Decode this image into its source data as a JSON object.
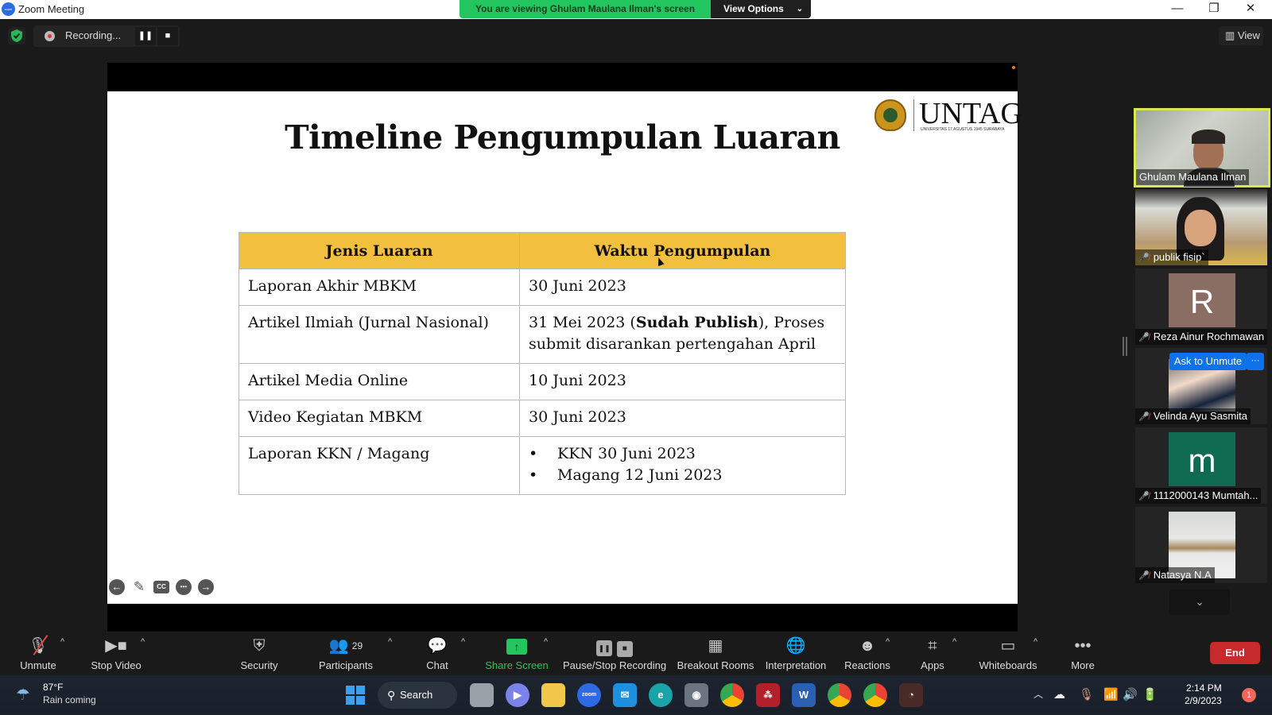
{
  "window": {
    "app_name": "Zoom Meeting",
    "logo_text": "zoom",
    "minimize": "—",
    "restore": "❐",
    "close": "✕"
  },
  "share_banner": {
    "text": "You are viewing Ghulam Maulana Ilman's screen",
    "view_options": "View Options",
    "chevron": "⌄"
  },
  "topbar": {
    "recording_label": "Recording...",
    "pause_glyph": "❚❚",
    "stop_glyph": "■",
    "view_label": "View",
    "view_glyph": "▥"
  },
  "slide": {
    "title": "Timeline Pengumpulan Luaran",
    "logo": {
      "word": "UNTAG",
      "subtitle": "UNIVERSITAS 17 AGUSTUS 1945 SURABAYA"
    },
    "table": {
      "headers": [
        "Jenis Luaran",
        "Waktu Pengumpulan"
      ],
      "rows": [
        {
          "type": "Laporan Akhir MBKM",
          "time": "30 Juni 2023"
        },
        {
          "type": "Artikel Ilmiah (Jurnal Nasional)",
          "time_prefix": "31 Mei 2023 (",
          "time_bold": "Sudah Publish",
          "time_suffix": "), Proses submit disarankan pertengahan April"
        },
        {
          "type": "Artikel Media Online",
          "time": "10 Juni 2023"
        },
        {
          "type": "Video Kegiatan MBKM",
          "time": "30 Juni 2023"
        },
        {
          "type": "Laporan KKN / Magang",
          "time_list": [
            "KKN 30 Juni 2023",
            "Magang 12 Juni 2023"
          ]
        }
      ]
    },
    "controls": {
      "prev": "←",
      "pen": "✎",
      "cc": "CC",
      "more": "•••",
      "next": "→"
    }
  },
  "participants": [
    {
      "name": "Ghulam Maulana Ilman",
      "type": "video",
      "active": true,
      "muted": false
    },
    {
      "name": "publik fisip`",
      "type": "video",
      "muted": true
    },
    {
      "name": "Reza Ainur Rochmawan",
      "type": "avatar",
      "initial": "R",
      "color": "#8a6e63",
      "muted": true
    },
    {
      "name": "Velinda Ayu Sasmita",
      "type": "photo",
      "muted": true
    },
    {
      "name": "1112000143 Mumtah...",
      "type": "avatar",
      "initial": "m",
      "color": "#0f6b52",
      "muted": true
    },
    {
      "name": "Natasya N.A",
      "type": "photo",
      "muted": true
    }
  ],
  "hover_actions": {
    "ask_to_unmute": "Ask to Unmute",
    "more": "···"
  },
  "scroll_down_glyph": "⌄",
  "toolbar": {
    "unmute": "Unmute",
    "stop_video": "Stop Video",
    "security": "Security",
    "participants": "Participants",
    "participants_count": "29",
    "chat": "Chat",
    "share_screen": "Share Screen",
    "pause_stop_recording": "Pause/Stop Recording",
    "breakout_rooms": "Breakout Rooms",
    "interpretation": "Interpretation",
    "reactions": "Reactions",
    "apps": "Apps",
    "whiteboards": "Whiteboards",
    "more": "More",
    "end": "End",
    "caret": "^",
    "share_color": "#22c55e",
    "end_color": "#c72a2a"
  },
  "taskbar": {
    "weather_temp": "87°F",
    "weather_desc": "Rain coming",
    "search_label": "Search",
    "time": "2:14 PM",
    "date": "2/9/2023",
    "notifications": "1",
    "apps": [
      "Task View",
      "Teams Chat",
      "File Explorer",
      "Zoom",
      "Mail",
      "Edge",
      "Camera",
      "Chrome",
      "Mendeley",
      "Word",
      "Chrome Profile",
      "Chrome Profile P",
      "Recorder"
    ]
  }
}
